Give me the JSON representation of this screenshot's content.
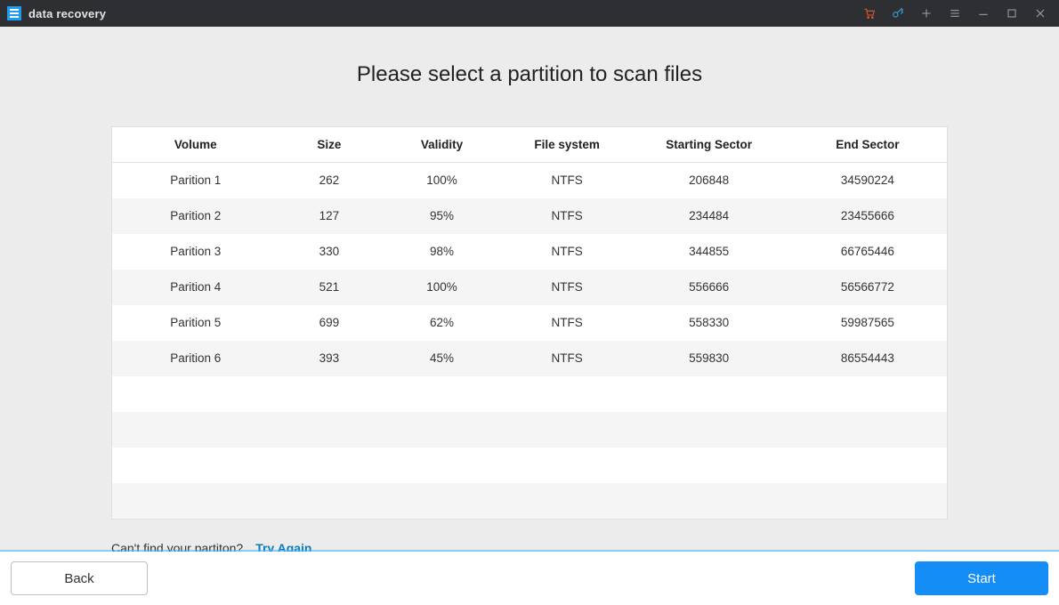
{
  "app": {
    "title": "data recovery"
  },
  "titlebar_icons": {
    "cart": "cart-icon",
    "key": "key-icon",
    "plus": "plus-icon",
    "hamburger": "menu-icon",
    "minimize": "minimize-icon",
    "maximize": "maximize-icon",
    "close": "close-icon"
  },
  "heading": "Please select a partition to scan files",
  "columns": {
    "volume": "Volume",
    "size": "Size",
    "validity": "Validity",
    "filesystem": "File system",
    "start": "Starting Sector",
    "end": "End Sector"
  },
  "rows": [
    {
      "volume": "Parition 1",
      "size": "262",
      "validity": "100%",
      "fs": "NTFS",
      "start": "206848",
      "end": "34590224"
    },
    {
      "volume": "Parition 2",
      "size": "127",
      "validity": "95%",
      "fs": "NTFS",
      "start": "234484",
      "end": "23455666"
    },
    {
      "volume": "Parition 3",
      "size": "330",
      "validity": "98%",
      "fs": "NTFS",
      "start": "344855",
      "end": "66765446"
    },
    {
      "volume": "Parition 4",
      "size": "521",
      "validity": "100%",
      "fs": "NTFS",
      "start": "556666",
      "end": "56566772"
    },
    {
      "volume": "Parition 5",
      "size": "699",
      "validity": "62%",
      "fs": "NTFS",
      "start": "558330",
      "end": "59987565"
    },
    {
      "volume": "Parition 6",
      "size": "393",
      "validity": "45%",
      "fs": "NTFS",
      "start": "559830",
      "end": "86554443"
    }
  ],
  "empty_rows": 4,
  "below": {
    "prompt": "Can't find your partiton?",
    "try_again": "Try Again"
  },
  "footer": {
    "back": "Back",
    "start": "Start"
  }
}
